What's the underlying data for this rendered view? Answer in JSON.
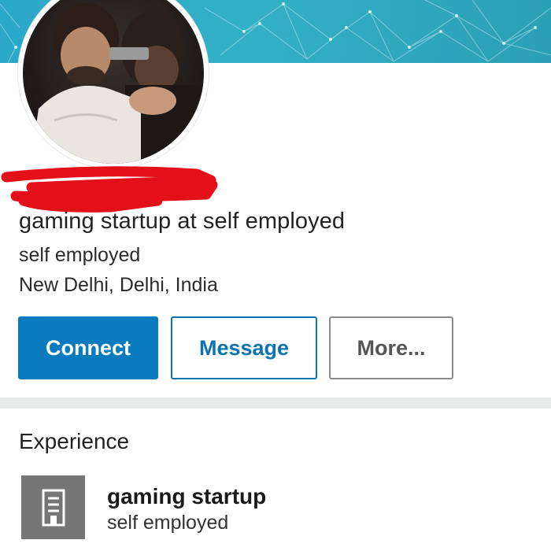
{
  "profile": {
    "headline": "gaming startup at self employed",
    "company": "self employed",
    "location": "New Delhi, Delhi, India"
  },
  "actions": {
    "connect_label": "Connect",
    "message_label": "Message",
    "more_label": "More..."
  },
  "experience": {
    "section_title": "Experience",
    "items": [
      {
        "title": "gaming startup",
        "company": "self employed",
        "icon": "building-icon"
      }
    ]
  },
  "colors": {
    "primary": "#0a7bbf",
    "banner": "#2aa7c9",
    "redaction": "#e3101a",
    "company_logo_bg": "#767676"
  }
}
